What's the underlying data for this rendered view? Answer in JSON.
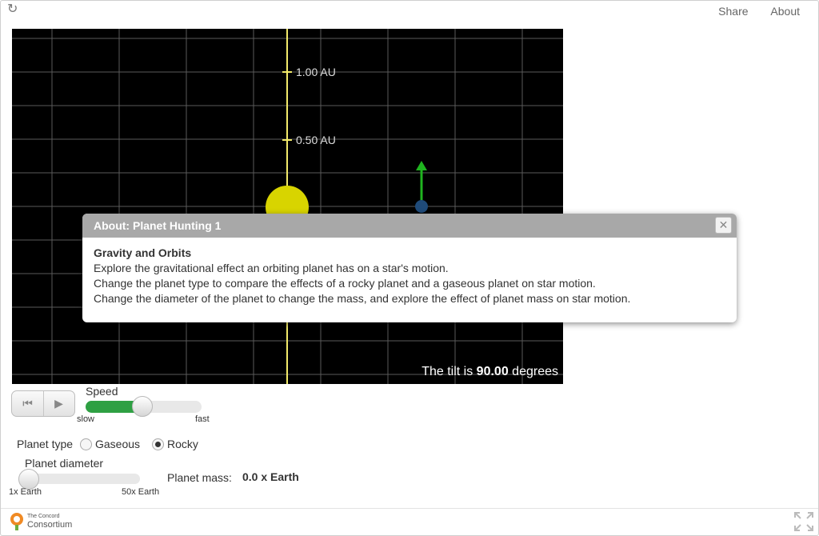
{
  "header": {
    "reload_icon": "reload-icon",
    "share_label": "Share",
    "about_label": "About"
  },
  "stage": {
    "axis_labels": [
      "1.00 AU",
      "0.50 AU"
    ],
    "tilt_prefix": "The tilt is",
    "tilt_value": "90.00",
    "tilt_suffix": "degrees",
    "colors": {
      "background": "#000000",
      "grid": "#5a5a5a",
      "axis": "#f2ea6a",
      "star": "#d8d400",
      "planet": "#1f4b7a",
      "velocity_arrow": "#1fb41f"
    }
  },
  "dialog": {
    "title": "About: Planet Hunting 1",
    "close_icon": "close-icon",
    "heading": "Gravity and Orbits",
    "lines": [
      "Explore the gravitational effect an orbiting planet has on a star's motion.",
      "Change the planet type to compare the effects of a rocky planet and a gaseous planet on star motion.",
      "Change the diameter of the planet to change the mass, and explore the effect of planet mass on star motion."
    ]
  },
  "playback": {
    "reset_icon": "skip-to-start-icon",
    "play_icon": "play-icon"
  },
  "speed": {
    "label": "Speed",
    "min_label": "slow",
    "max_label": "fast",
    "value_fraction": 0.5,
    "fill_color": "#2ea043"
  },
  "planet_type": {
    "label": "Planet type",
    "options": [
      "Gaseous",
      "Rocky"
    ],
    "selected": "Rocky"
  },
  "planet_diameter": {
    "label": "Planet diameter",
    "min_label": "1x Earth",
    "max_label": "50x Earth",
    "value_fraction": 0.0
  },
  "planet_mass": {
    "label": "Planet mass:",
    "value": "0.0 x Earth"
  },
  "footer": {
    "logo_line1": "The Concord",
    "logo_line2": "Consortium",
    "fullscreen_icon": "fullscreen-icon"
  }
}
